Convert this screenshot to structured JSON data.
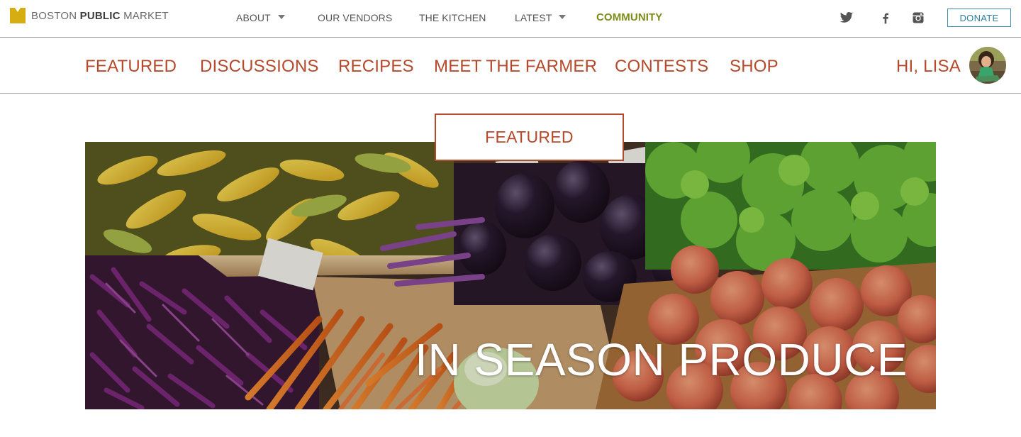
{
  "brand": {
    "name_part1": "BOSTON",
    "name_part2": "PUBLIC",
    "name_part3": "MARKET",
    "color": "#d6ad12"
  },
  "top_nav": {
    "about": "ABOUT",
    "vendors": "OUR VENDORS",
    "kitchen": "THE KITCHEN",
    "latest": "LATEST",
    "community": "COMMUNITY",
    "active_color": "#7e8a1a"
  },
  "social": {
    "icons": [
      "twitter-icon",
      "facebook-icon",
      "instagram-icon"
    ]
  },
  "donate_label": "DONATE",
  "community_nav": {
    "featured": "FEATURED",
    "discussions": "DISCUSSIONS",
    "recipes": "RECIPES",
    "meet_the_farmer": "MEET THE FARMER",
    "contests": "CONTESTS",
    "shop": "SHOP",
    "accent_color": "#b5492b"
  },
  "user": {
    "greeting": "HI, LISA"
  },
  "section": {
    "tab_label": "FEATURED"
  },
  "hero": {
    "title": "IN SEASON PRODUCE"
  }
}
